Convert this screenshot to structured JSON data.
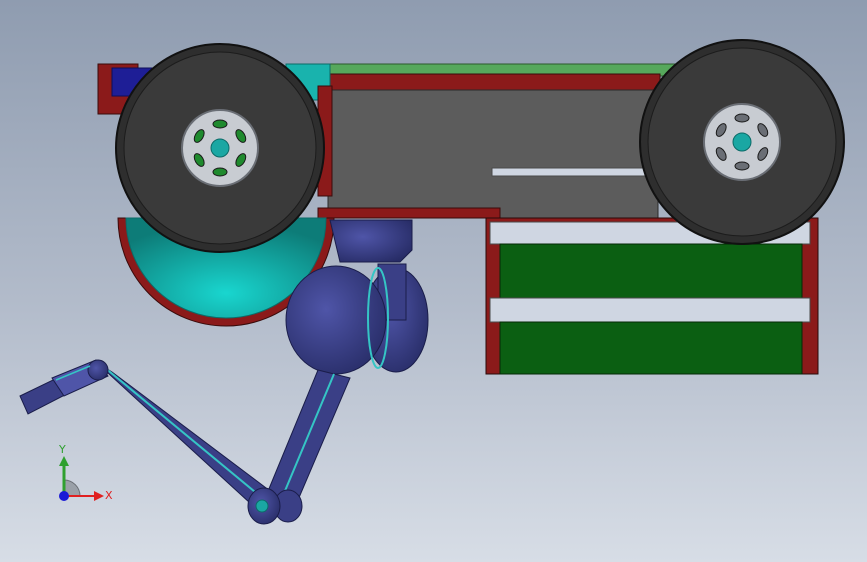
{
  "viewport": {
    "background_top": "#8f9cb0",
    "background_bottom": "#d7dde6"
  },
  "colors": {
    "frame_red": "#8b1a1a",
    "body_gray": "#5c5c5c",
    "tire": "#3a3a3a",
    "rim": "#c8ccd2",
    "hub_teal": "#1aa7a3",
    "teal_guard": "#19b3ad",
    "battery_green": "#0b5f12",
    "top_green": "#56a85c",
    "linkage_navy": "#3a3f86",
    "edge_cyan": "#35c5c5",
    "slot_light": "#cfd6e2"
  },
  "model": {
    "parts": [
      "chassis-frame",
      "front-wheel",
      "rear-wheel",
      "teal-guard",
      "battery-pack",
      "linkage-arm",
      "gripper"
    ]
  },
  "triad": {
    "x_label": "X",
    "y_label": "Y",
    "x_color": "#e02020",
    "y_color": "#2fa02f",
    "origin_color": "#1a1ad6"
  }
}
